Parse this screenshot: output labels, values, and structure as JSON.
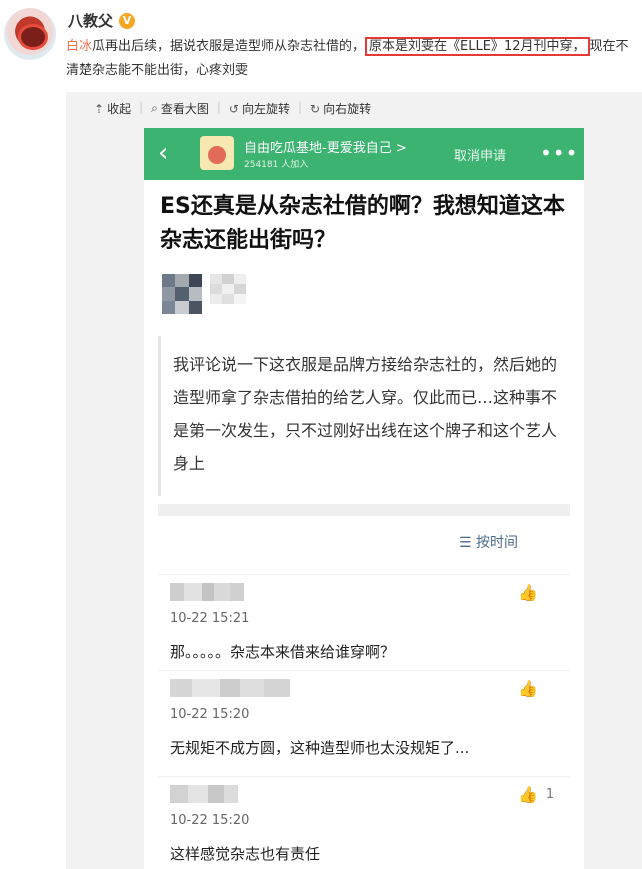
{
  "post": {
    "author": "八教父",
    "verified_badge": "V",
    "tag": "白冰",
    "text_before": "瓜再出后续，据说衣服是造型师从杂志社借的，",
    "highlight": "原本是刘雯在《ELLE》12月刊中穿，",
    "text_after": "现在不清楚杂志能不能出街，心疼刘雯"
  },
  "image_toolbar": {
    "items": [
      {
        "icon": "collapse-icon",
        "label": "收起"
      },
      {
        "icon": "zoom-icon",
        "label": "查看大图"
      },
      {
        "icon": "rotate-left-icon",
        "label": "向左旋转"
      },
      {
        "icon": "rotate-right-icon",
        "label": "向右旋转"
      }
    ]
  },
  "screenshot": {
    "group_bar": {
      "name": "自由吃瓜基地-更爱我自己 >",
      "count": "254181 人加入",
      "cancel": "取消申请",
      "more": "•••",
      "color": "#3cb371"
    },
    "title": "ES还真是从杂志社借的啊？我想知道这本杂志还能出街吗？",
    "quote": "我评论说一下这衣服是品牌方接给杂志社的，然后她的造型师拿了杂志借拍的给艺人穿。仅此而已…这种事不是第一次发生，只不过刚好出线在这个牌子和这个艺人身上",
    "sort_label": "按时间",
    "comments": [
      {
        "time": "10-22 15:21",
        "text": "那。。。。。杂志本来借来给谁穿啊？",
        "likes": ""
      },
      {
        "time": "10-22 15:20",
        "text": "无规矩不成方圆，这种造型师也太没规矩了...",
        "likes": ""
      },
      {
        "time": "10-22 15:20",
        "text": "这样感觉杂志也有责任",
        "likes": "1"
      }
    ]
  }
}
